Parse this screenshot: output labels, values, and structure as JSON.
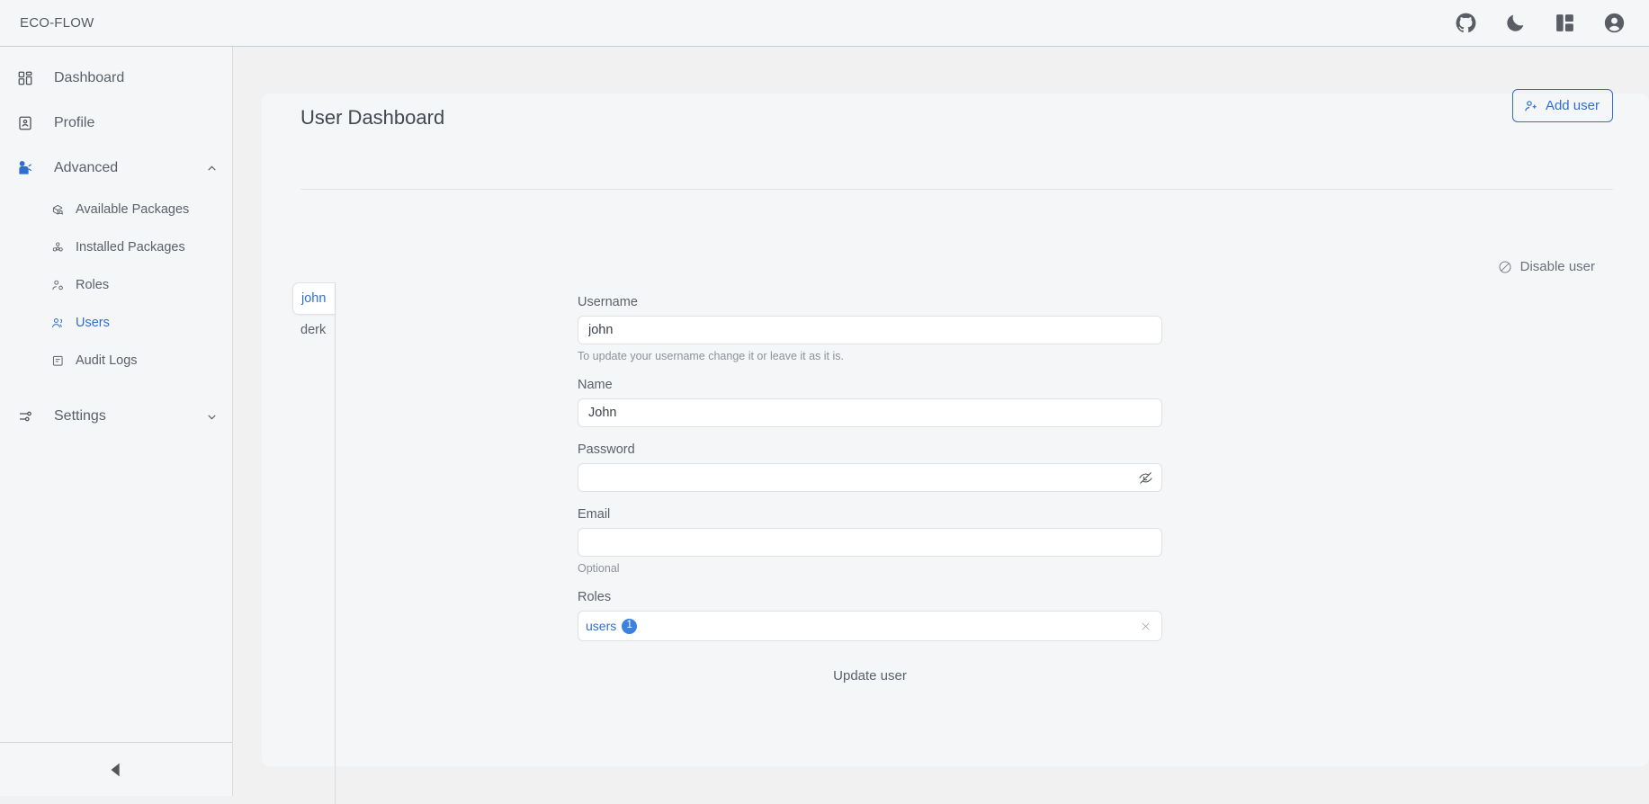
{
  "topbar": {
    "brand": "ECO-FLOW",
    "actions": [
      {
        "name": "github-icon",
        "label": "GitHub"
      },
      {
        "name": "moon-icon",
        "label": "Toggle dark mode"
      },
      {
        "name": "layout-icon",
        "label": "Layout"
      },
      {
        "name": "user-circle-icon",
        "label": "Account"
      }
    ]
  },
  "sidebar": {
    "items": [
      {
        "label": "Dashboard",
        "icon": "grid-icon"
      },
      {
        "label": "Profile",
        "icon": "id-card-icon"
      },
      {
        "label": "Advanced",
        "icon": "gear-robot-icon",
        "chevron": "chevron-up-icon",
        "expanded": true
      },
      {
        "label": "Settings",
        "icon": "sliders-icon",
        "chevron": "chevron-down-icon",
        "expanded": false
      }
    ],
    "advanced_children": [
      {
        "label": "Available Packages",
        "icon": "package-search-icon",
        "active": false
      },
      {
        "label": "Installed Packages",
        "icon": "packages-icon",
        "active": false
      },
      {
        "label": "Roles",
        "icon": "user-cog-icon",
        "active": false
      },
      {
        "label": "Users",
        "icon": "users-icon",
        "active": true
      },
      {
        "label": "Audit Logs",
        "icon": "log-icon",
        "active": false
      }
    ],
    "collapse_icon": "collapse-left-triangle-icon"
  },
  "page": {
    "title": "User Dashboard",
    "add_user_label": "Add user",
    "disable_user_label": "Disable user"
  },
  "user_tabs": [
    {
      "label": "john",
      "active": true
    },
    {
      "label": "derk",
      "active": false
    }
  ],
  "form": {
    "username": {
      "label": "Username",
      "value": "john",
      "placeholder": "",
      "help": "To update your username change it or leave it as it is."
    },
    "name": {
      "label": "Name",
      "value": "John",
      "placeholder": ""
    },
    "password": {
      "label": "Password",
      "value": "",
      "placeholder": "",
      "toggle_icon": "eye-off-icon"
    },
    "email": {
      "label": "Email",
      "value": "",
      "placeholder": "",
      "help": "Optional"
    },
    "roles": {
      "label": "Roles",
      "selected": [
        {
          "label": "users",
          "count": "1"
        }
      ],
      "clear_icon": "close-icon"
    },
    "submit_label": "Update user"
  },
  "colors": {
    "accent": "#2f6fd0",
    "badge": "#3b82e0",
    "sidebar_bg": "#f5f6f8",
    "main_bg": "#f1f1f2",
    "card_bg": "#f5f6f8",
    "text": "#5b616a"
  }
}
